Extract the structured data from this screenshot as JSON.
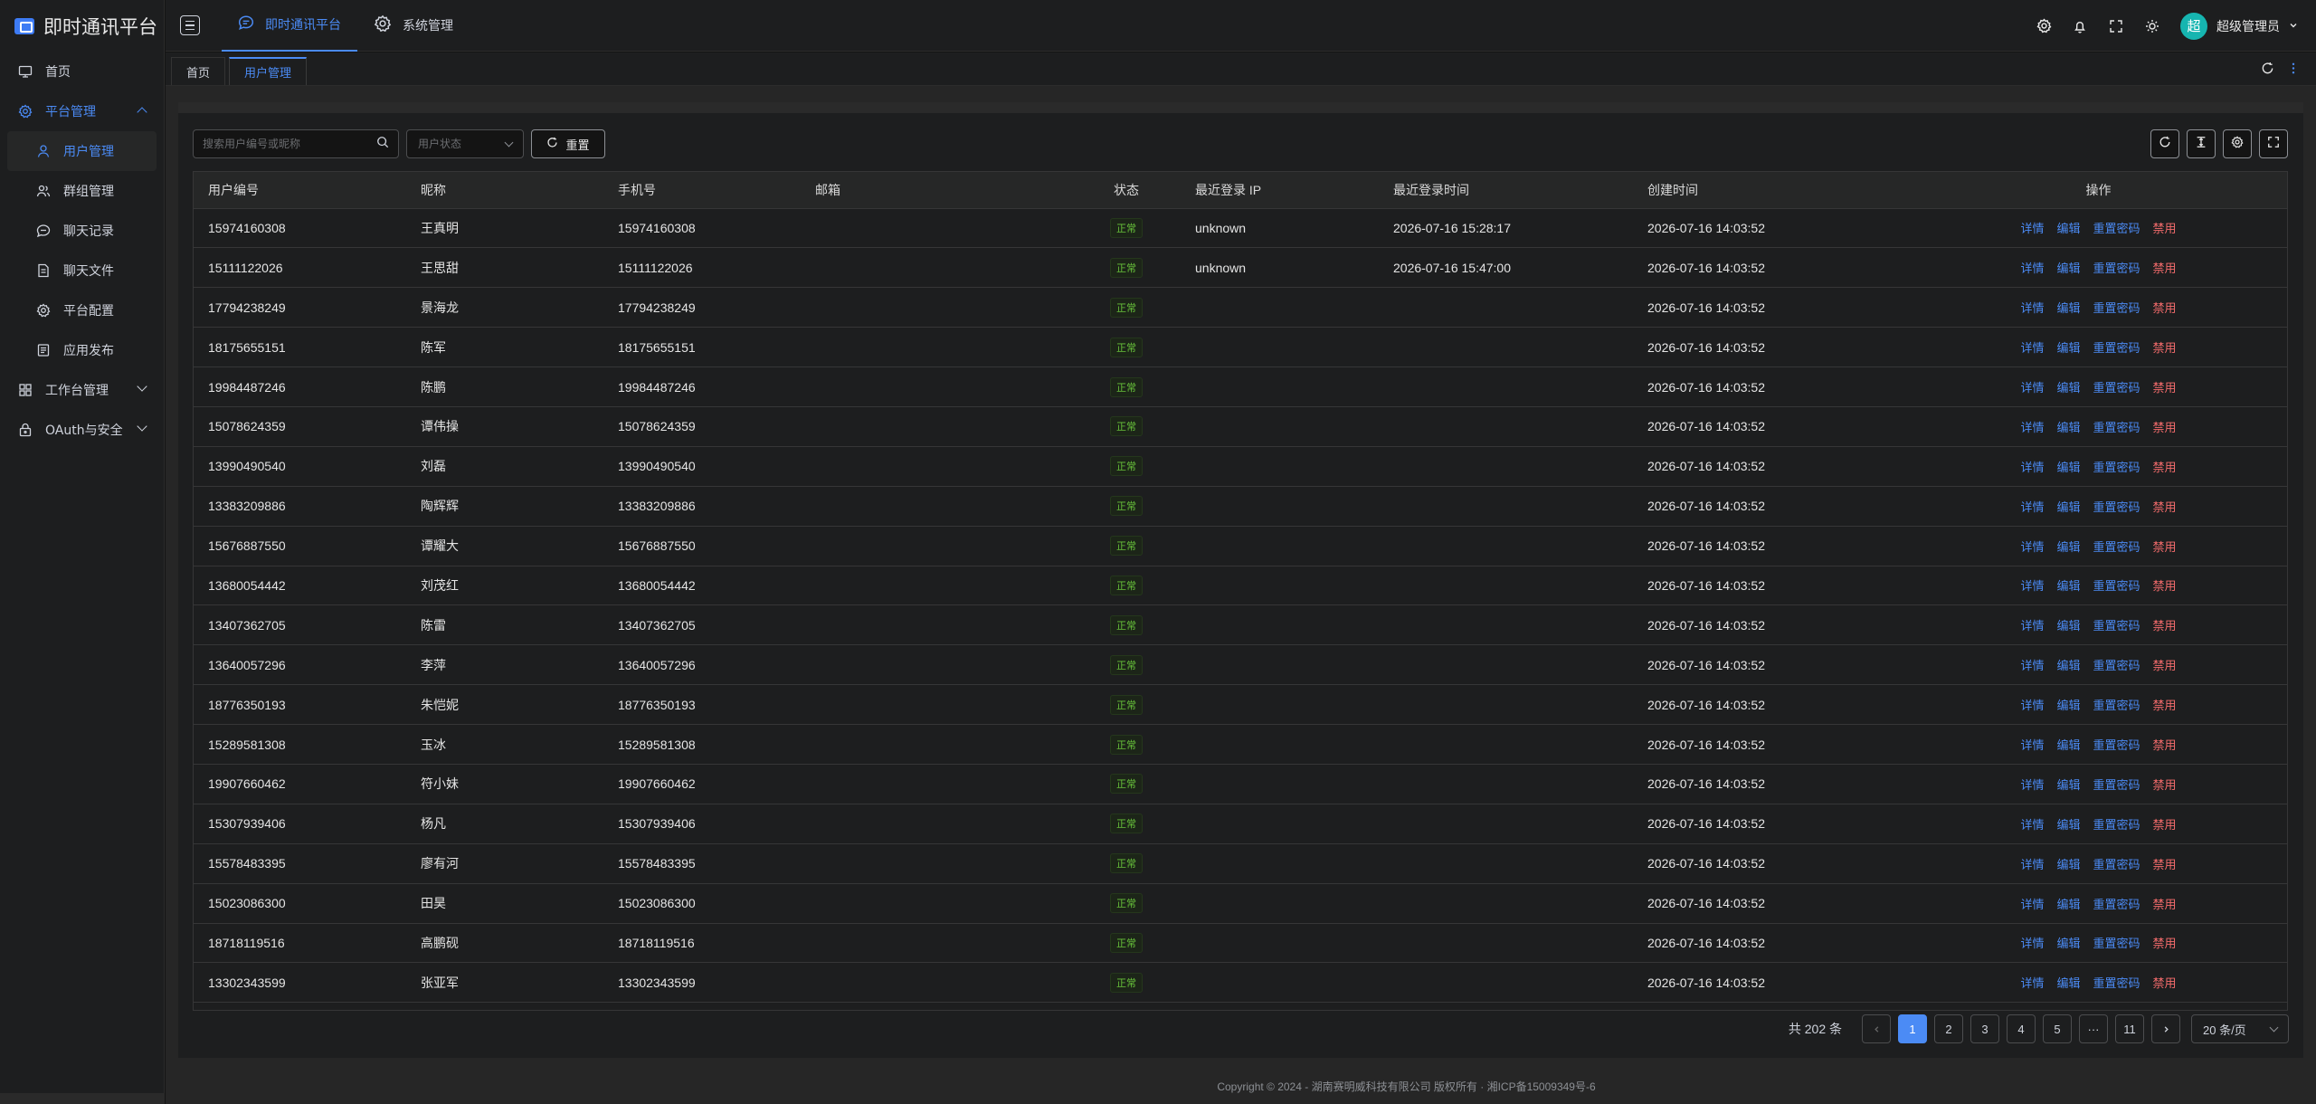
{
  "app": {
    "title": "即时通讯平台"
  },
  "sidebar": {
    "items": [
      {
        "label": "首页"
      },
      {
        "label": "平台管理"
      },
      {
        "label": "用户管理"
      },
      {
        "label": "群组管理"
      },
      {
        "label": "聊天记录"
      },
      {
        "label": "聊天文件"
      },
      {
        "label": "平台配置"
      },
      {
        "label": "应用发布"
      },
      {
        "label": "工作台管理"
      },
      {
        "label": "OAuth与安全"
      }
    ]
  },
  "header": {
    "nav": [
      {
        "label": "即时通讯平台"
      },
      {
        "label": "系统管理"
      }
    ],
    "user": {
      "avatar_text": "超",
      "name": "超级管理员"
    }
  },
  "tabs": [
    {
      "label": "首页"
    },
    {
      "label": "用户管理"
    }
  ],
  "toolbar": {
    "search_placeholder": "搜索用户编号或昵称",
    "status_placeholder": "用户状态",
    "reset_label": "重置"
  },
  "table": {
    "columns": [
      "用户编号",
      "昵称",
      "手机号",
      "邮箱",
      "状态",
      "最近登录 IP",
      "最近登录时间",
      "创建时间",
      "操作"
    ],
    "actions": {
      "detail": "详情",
      "edit": "编辑",
      "reset_password": "重置密码",
      "disable": "禁用"
    },
    "rows": [
      {
        "id": "15974160308",
        "nickname": "王真明",
        "phone": "15974160308",
        "email": "",
        "status": "正常",
        "ip": "unknown",
        "last_login": "2026-07-16 15:28:17",
        "created": "2026-07-16 14:03:52"
      },
      {
        "id": "15111122026",
        "nickname": "王思甜",
        "phone": "15111122026",
        "email": "",
        "status": "正常",
        "ip": "unknown",
        "last_login": "2026-07-16 15:47:00",
        "created": "2026-07-16 14:03:52"
      },
      {
        "id": "17794238249",
        "nickname": "景海龙",
        "phone": "17794238249",
        "email": "",
        "status": "正常",
        "ip": "",
        "last_login": "",
        "created": "2026-07-16 14:03:52"
      },
      {
        "id": "18175655151",
        "nickname": "陈军",
        "phone": "18175655151",
        "email": "",
        "status": "正常",
        "ip": "",
        "last_login": "",
        "created": "2026-07-16 14:03:52"
      },
      {
        "id": "19984487246",
        "nickname": "陈鹏",
        "phone": "19984487246",
        "email": "",
        "status": "正常",
        "ip": "",
        "last_login": "",
        "created": "2026-07-16 14:03:52"
      },
      {
        "id": "15078624359",
        "nickname": "谭伟操",
        "phone": "15078624359",
        "email": "",
        "status": "正常",
        "ip": "",
        "last_login": "",
        "created": "2026-07-16 14:03:52"
      },
      {
        "id": "13990490540",
        "nickname": "刘磊",
        "phone": "13990490540",
        "email": "",
        "status": "正常",
        "ip": "",
        "last_login": "",
        "created": "2026-07-16 14:03:52"
      },
      {
        "id": "13383209886",
        "nickname": "陶辉辉",
        "phone": "13383209886",
        "email": "",
        "status": "正常",
        "ip": "",
        "last_login": "",
        "created": "2026-07-16 14:03:52"
      },
      {
        "id": "15676887550",
        "nickname": "谭耀大",
        "phone": "15676887550",
        "email": "",
        "status": "正常",
        "ip": "",
        "last_login": "",
        "created": "2026-07-16 14:03:52"
      },
      {
        "id": "13680054442",
        "nickname": "刘茂红",
        "phone": "13680054442",
        "email": "",
        "status": "正常",
        "ip": "",
        "last_login": "",
        "created": "2026-07-16 14:03:52"
      },
      {
        "id": "13407362705",
        "nickname": "陈雷",
        "phone": "13407362705",
        "email": "",
        "status": "正常",
        "ip": "",
        "last_login": "",
        "created": "2026-07-16 14:03:52"
      },
      {
        "id": "13640057296",
        "nickname": "李萍",
        "phone": "13640057296",
        "email": "",
        "status": "正常",
        "ip": "",
        "last_login": "",
        "created": "2026-07-16 14:03:52"
      },
      {
        "id": "18776350193",
        "nickname": "朱恺妮",
        "phone": "18776350193",
        "email": "",
        "status": "正常",
        "ip": "",
        "last_login": "",
        "created": "2026-07-16 14:03:52"
      },
      {
        "id": "15289581308",
        "nickname": "玉冰",
        "phone": "15289581308",
        "email": "",
        "status": "正常",
        "ip": "",
        "last_login": "",
        "created": "2026-07-16 14:03:52"
      },
      {
        "id": "19907660462",
        "nickname": "符小妹",
        "phone": "19907660462",
        "email": "",
        "status": "正常",
        "ip": "",
        "last_login": "",
        "created": "2026-07-16 14:03:52"
      },
      {
        "id": "15307939406",
        "nickname": "杨凡",
        "phone": "15307939406",
        "email": "",
        "status": "正常",
        "ip": "",
        "last_login": "",
        "created": "2026-07-16 14:03:52"
      },
      {
        "id": "15578483395",
        "nickname": "廖有河",
        "phone": "15578483395",
        "email": "",
        "status": "正常",
        "ip": "",
        "last_login": "",
        "created": "2026-07-16 14:03:52"
      },
      {
        "id": "15023086300",
        "nickname": "田昊",
        "phone": "15023086300",
        "email": "",
        "status": "正常",
        "ip": "",
        "last_login": "",
        "created": "2026-07-16 14:03:52"
      },
      {
        "id": "18718119516",
        "nickname": "高鹏砚",
        "phone": "18718119516",
        "email": "",
        "status": "正常",
        "ip": "",
        "last_login": "",
        "created": "2026-07-16 14:03:52"
      },
      {
        "id": "13302343599",
        "nickname": "张亚军",
        "phone": "13302343599",
        "email": "",
        "status": "正常",
        "ip": "",
        "last_login": "",
        "created": "2026-07-16 14:03:52"
      }
    ]
  },
  "pagination": {
    "total_text": "共 202 条",
    "pages": [
      "1",
      "2",
      "3",
      "4",
      "5",
      "···",
      "11"
    ],
    "current": 1,
    "page_size": "20 条/页"
  },
  "footer": {
    "copyright": "Copyright © 2024 - 湖南赛明威科技有限公司 版权所有 · 湘ICP备15009349号-6"
  },
  "colors": {
    "accent": "#4b8bf5",
    "success": "#67c23a",
    "danger": "#f56c6c",
    "avatar_bg": "#16b5b0"
  },
  "icons": {
    "sidebar": [
      "monitor-icon",
      "gear-icon",
      "user-icon",
      "users-icon",
      "chat-icon",
      "file-icon",
      "gear-icon",
      "app-icon",
      "grid-icon",
      "lock-icon"
    ],
    "header": [
      "settings-icon",
      "bell-icon",
      "fullscreen-icon",
      "theme-sun-icon"
    ]
  }
}
